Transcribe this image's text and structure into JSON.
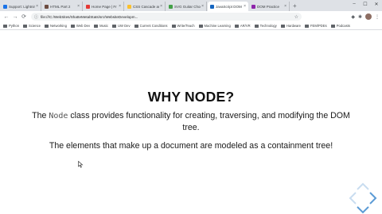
{
  "tabs": [
    {
      "label": "Support: Lightning",
      "favicon_color": "#1a73e8",
      "active": false
    },
    {
      "label": "HTML Part 2",
      "favicon_color": "#6d4c41",
      "active": false
    },
    {
      "label": "Home Page | Fr",
      "favicon_color": "#e53935",
      "active": false
    },
    {
      "label": "CSS Cascade and",
      "favicon_color": "#fbc02d",
      "active": false
    },
    {
      "label": "SVG Guitar Chords",
      "favicon_color": "#43a047",
      "active": false
    },
    {
      "label": "JavaScript DOM obje",
      "favicon_color": "#1565c0",
      "active": true
    },
    {
      "label": "DOM Practice",
      "favicon_color": "#8e24aa",
      "active": false
    }
  ],
  "toolbar": {
    "url": "file:///C:/WebSites/ShatteMetalStats/src/WebsiteDevelopm...",
    "back": "←",
    "forward": "→",
    "reload": "⟳",
    "home": "⌂"
  },
  "window_controls": {
    "minimize": "–",
    "maximize": "☐",
    "close": "✕"
  },
  "bookmarks": [
    "Python",
    "Science",
    "Networking",
    "Web Dev",
    "Music",
    "UW Dev",
    "Current Conditions",
    "Write/Teach",
    "Machine Learning",
    "AR/VR",
    "Technology",
    "Hardware",
    "FEM/PDEs",
    "Podcasts"
  ],
  "slide": {
    "title": "WHY NODE?",
    "para1_pre": "The ",
    "para1_code": "Node",
    "para1_post": " class provides functionality for creating, traversing, and modifying the DOM tree.",
    "para2": "The elements that make up a document are modeled as a containment tree!"
  },
  "colors": {
    "nav_arrow": "#5b9bd5",
    "nav_arrow_dim": "#c9ddf0"
  }
}
